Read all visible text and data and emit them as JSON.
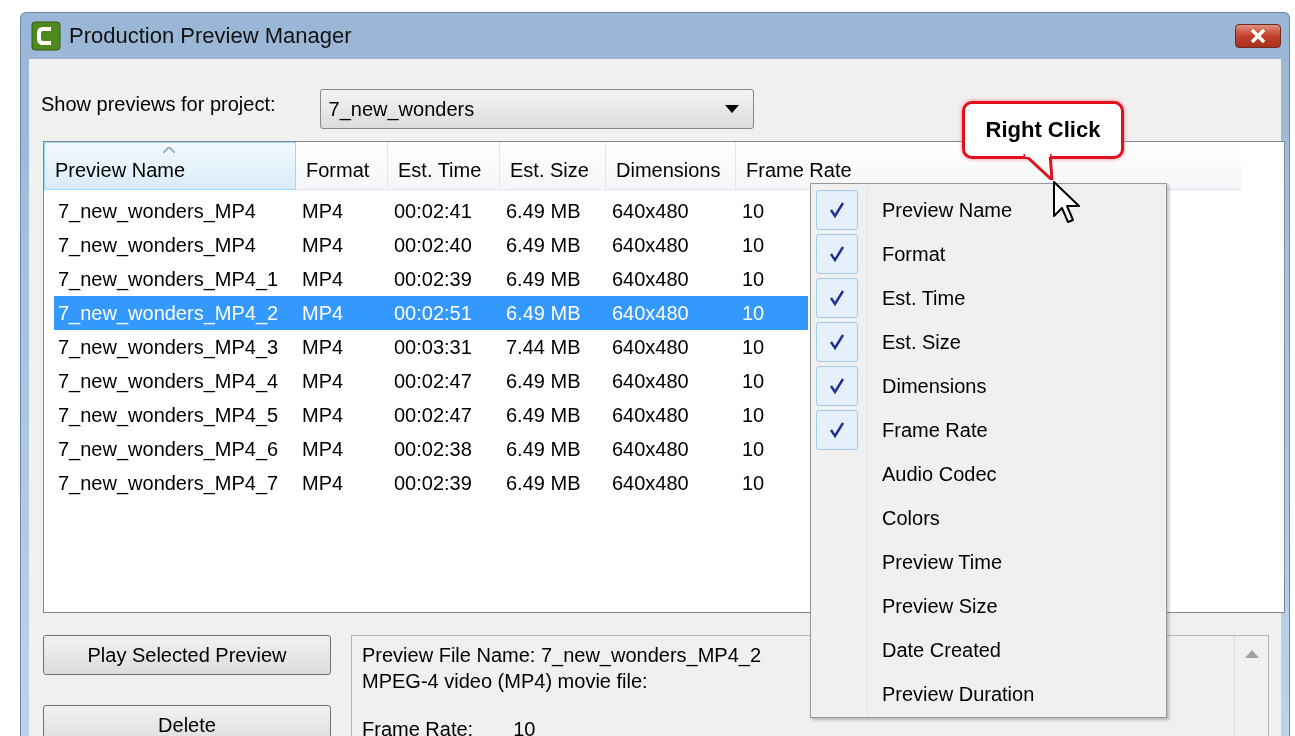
{
  "window": {
    "title": "Production Preview Manager"
  },
  "project": {
    "label": "Show previews for project:",
    "value": "7_new_wonders"
  },
  "table": {
    "columns": [
      {
        "label": "Preview Name",
        "sorted": true
      },
      {
        "label": "Format",
        "sorted": false
      },
      {
        "label": "Est. Time",
        "sorted": false
      },
      {
        "label": "Est. Size",
        "sorted": false
      },
      {
        "label": "Dimensions",
        "sorted": false
      },
      {
        "label": "Frame Rate",
        "sorted": false
      }
    ],
    "rows": [
      {
        "cells": [
          "7_new_wonders_MP4",
          "MP4",
          "00:02:41",
          "6.49 MB",
          "640x480",
          "10"
        ],
        "selected": false
      },
      {
        "cells": [
          "7_new_wonders_MP4",
          "MP4",
          "00:02:40",
          "6.49 MB",
          "640x480",
          "10"
        ],
        "selected": false
      },
      {
        "cells": [
          "7_new_wonders_MP4_1",
          "MP4",
          "00:02:39",
          "6.49 MB",
          "640x480",
          "10"
        ],
        "selected": false
      },
      {
        "cells": [
          "7_new_wonders_MP4_2",
          "MP4",
          "00:02:51",
          "6.49 MB",
          "640x480",
          "10"
        ],
        "selected": true
      },
      {
        "cells": [
          "7_new_wonders_MP4_3",
          "MP4",
          "00:03:31",
          "7.44 MB",
          "640x480",
          "10"
        ],
        "selected": false
      },
      {
        "cells": [
          "7_new_wonders_MP4_4",
          "MP4",
          "00:02:47",
          "6.49 MB",
          "640x480",
          "10"
        ],
        "selected": false
      },
      {
        "cells": [
          "7_new_wonders_MP4_5",
          "MP4",
          "00:02:47",
          "6.49 MB",
          "640x480",
          "10"
        ],
        "selected": false
      },
      {
        "cells": [
          "7_new_wonders_MP4_6",
          "MP4",
          "00:02:38",
          "6.49 MB",
          "640x480",
          "10"
        ],
        "selected": false
      },
      {
        "cells": [
          "7_new_wonders_MP4_7",
          "MP4",
          "00:02:39",
          "6.49 MB",
          "640x480",
          "10"
        ],
        "selected": false
      }
    ]
  },
  "context_menu": {
    "items": [
      {
        "label": "Preview Name",
        "checked": true
      },
      {
        "label": "Format",
        "checked": true
      },
      {
        "label": "Est. Time",
        "checked": true
      },
      {
        "label": "Est. Size",
        "checked": true
      },
      {
        "label": "Dimensions",
        "checked": true
      },
      {
        "label": "Frame Rate",
        "checked": true
      },
      {
        "label": "Audio Codec",
        "checked": false
      },
      {
        "label": "Colors",
        "checked": false
      },
      {
        "label": "Preview Time",
        "checked": false
      },
      {
        "label": "Preview Size",
        "checked": false
      },
      {
        "label": "Date Created",
        "checked": false
      },
      {
        "label": "Preview Duration",
        "checked": false
      }
    ]
  },
  "callout": {
    "text": "Right Click"
  },
  "buttons": [
    "Play Selected Preview",
    "Delete"
  ],
  "details": {
    "lines": [
      "Preview File Name: 7_new_wonders_MP4_2",
      "MPEG-4 video (MP4) movie file:"
    ],
    "fields": [
      {
        "label": "Frame Rate:",
        "value": "10"
      }
    ]
  }
}
